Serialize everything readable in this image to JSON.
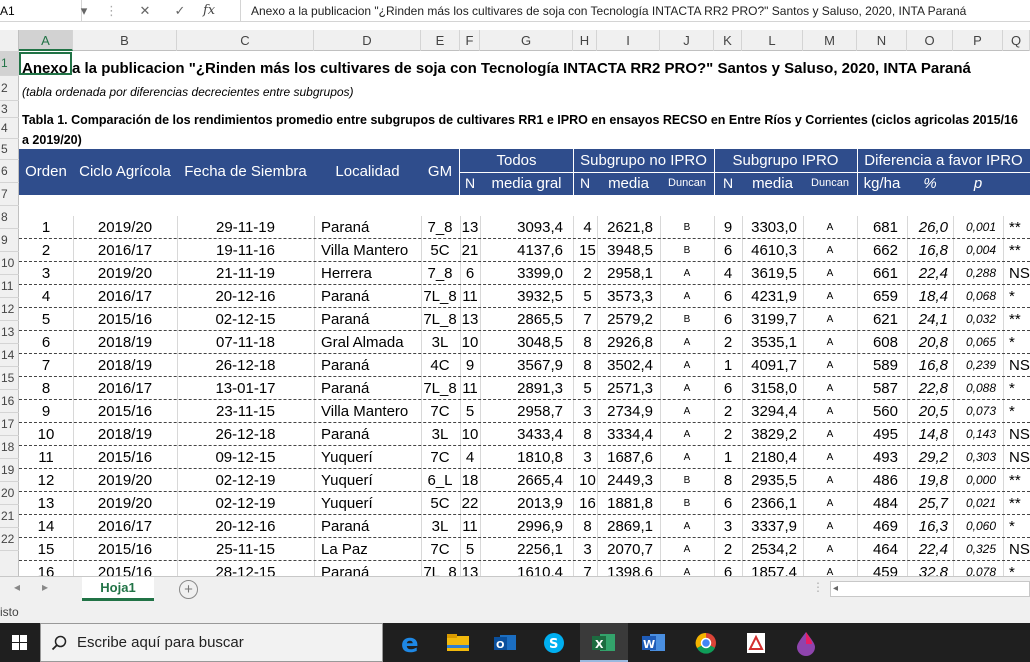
{
  "formula_bar": {
    "name_box": "A1",
    "fx": "fx",
    "content": "Anexo a la publicacion \"¿Rinden más los cultivares de soja con Tecnología INTACTA RR2 PRO?\"  Santos y Saluso, 2020, INTA Paraná"
  },
  "columns": [
    "A",
    "B",
    "C",
    "D",
    "E",
    "F",
    "G",
    "H",
    "I",
    "J",
    "K",
    "L",
    "M",
    "N",
    "O",
    "P",
    "Q"
  ],
  "rows": [
    "1",
    "2",
    "3",
    "4",
    "5",
    "6",
    "7",
    "8",
    "9",
    "10",
    "11",
    "12",
    "13",
    "14",
    "15",
    "16",
    "17",
    "18",
    "19",
    "20",
    "21",
    "22"
  ],
  "sheet": {
    "title": "Anexo a la publicacion \"¿Rinden más los cultivares de soja con Tecnología INTACTA RR2 PRO?\"  Santos y Saluso, 2020, INTA Paraná",
    "subtitle": "(tabla ordenada por diferencias decrecientes entre subgrupos)",
    "table_title": "Tabla 1. Comparación de los rendimientos promedio entre subgrupos de cultivares RR1 e IPRO en ensayos RECSO en Entre Ríos y Corrientes (ciclos agricolas 2015/16 a 2019/20)"
  },
  "table_header": {
    "orden": "Orden",
    "ciclo": "Ciclo Agrícola",
    "fecha": "Fecha de Siembra",
    "localidad": "Localidad",
    "gm": "GM",
    "todos": "Todos",
    "no_ipro": "Subgrupo no IPRO",
    "ipro": "Subgrupo IPRO",
    "diferencia": "Diferencia a favor IPRO",
    "n": "N",
    "media_gral": "media gral",
    "media": "media",
    "duncan": "Duncan",
    "kgha": "kg/ha",
    "pct": "%",
    "p": "p"
  },
  "table_rows": [
    [
      "1",
      "2019/20",
      "29-11-19",
      "Paraná",
      "7_8",
      "13",
      "3093,4",
      "4",
      "2621,8",
      "B",
      "9",
      "3303,0",
      "A",
      "681",
      "26,0",
      "0,001",
      "**"
    ],
    [
      "2",
      "2016/17",
      "19-11-16",
      "Villa Mantero",
      "5C",
      "21",
      "4137,6",
      "15",
      "3948,5",
      "B",
      "6",
      "4610,3",
      "A",
      "662",
      "16,8",
      "0,004",
      "**"
    ],
    [
      "3",
      "2019/20",
      "21-11-19",
      "Herrera",
      "7_8",
      "6",
      "3399,0",
      "2",
      "2958,1",
      "A",
      "4",
      "3619,5",
      "A",
      "661",
      "22,4",
      "0,288",
      "NS"
    ],
    [
      "4",
      "2016/17",
      "20-12-16",
      "Paraná",
      "7L_8",
      "11",
      "3932,5",
      "5",
      "3573,3",
      "A",
      "6",
      "4231,9",
      "A",
      "659",
      "18,4",
      "0,068",
      "*"
    ],
    [
      "5",
      "2015/16",
      "02-12-15",
      "Paraná",
      "7L_8",
      "13",
      "2865,5",
      "7",
      "2579,2",
      "B",
      "6",
      "3199,7",
      "A",
      "621",
      "24,1",
      "0,032",
      "**"
    ],
    [
      "6",
      "2018/19",
      "07-11-18",
      "Gral Almada",
      "3L",
      "10",
      "3048,5",
      "8",
      "2926,8",
      "A",
      "2",
      "3535,1",
      "A",
      "608",
      "20,8",
      "0,065",
      "*"
    ],
    [
      "7",
      "2018/19",
      "26-12-18",
      "Paraná",
      "4C",
      "9",
      "3567,9",
      "8",
      "3502,4",
      "A",
      "1",
      "4091,7",
      "A",
      "589",
      "16,8",
      "0,239",
      "NS"
    ],
    [
      "8",
      "2016/17",
      "13-01-17",
      "Paraná",
      "7L_8",
      "11",
      "2891,3",
      "5",
      "2571,3",
      "A",
      "6",
      "3158,0",
      "A",
      "587",
      "22,8",
      "0,088",
      "*"
    ],
    [
      "9",
      "2015/16",
      "23-11-15",
      "Villa Mantero",
      "7C",
      "5",
      "2958,7",
      "3",
      "2734,9",
      "A",
      "2",
      "3294,4",
      "A",
      "560",
      "20,5",
      "0,073",
      "*"
    ],
    [
      "10",
      "2018/19",
      "26-12-18",
      "Paraná",
      "3L",
      "10",
      "3433,4",
      "8",
      "3334,4",
      "A",
      "2",
      "3829,2",
      "A",
      "495",
      "14,8",
      "0,143",
      "NS"
    ],
    [
      "11",
      "2015/16",
      "09-12-15",
      "Yuquerí",
      "7C",
      "4",
      "1810,8",
      "3",
      "1687,6",
      "A",
      "1",
      "2180,4",
      "A",
      "493",
      "29,2",
      "0,303",
      "NS"
    ],
    [
      "12",
      "2019/20",
      "02-12-19",
      "Yuquerí",
      "6_L",
      "18",
      "2665,4",
      "10",
      "2449,3",
      "B",
      "8",
      "2935,5",
      "A",
      "486",
      "19,8",
      "0,000",
      "**"
    ],
    [
      "13",
      "2019/20",
      "02-12-19",
      "Yuquerí",
      "5C",
      "22",
      "2013,9",
      "16",
      "1881,8",
      "B",
      "6",
      "2366,1",
      "A",
      "484",
      "25,7",
      "0,021",
      "**"
    ],
    [
      "14",
      "2016/17",
      "20-12-16",
      "Paraná",
      "3L",
      "11",
      "2996,9",
      "8",
      "2869,1",
      "A",
      "3",
      "3337,9",
      "A",
      "469",
      "16,3",
      "0,060",
      "*"
    ],
    [
      "15",
      "2015/16",
      "25-11-15",
      "La Paz",
      "7C",
      "5",
      "2256,1",
      "3",
      "2070,7",
      "A",
      "2",
      "2534,2",
      "A",
      "464",
      "22,4",
      "0,325",
      "NS"
    ],
    [
      "16",
      "2015/16",
      "28-12-15",
      "Paraná",
      "7L_8",
      "13",
      "1610,4",
      "7",
      "1398,6",
      "A",
      "6",
      "1857,4",
      "A",
      "459",
      "32,8",
      "0,078",
      "*"
    ]
  ],
  "sheet_tab": "Hoja1",
  "add_sheet": "+",
  "status": "isto",
  "taskbar": {
    "search_placeholder": "Escribe aquí para buscar",
    "icons": [
      "windows-start-icon",
      "search-icon",
      "edge-icon",
      "file-explorer-icon",
      "outlook-icon",
      "skype-icon",
      "excel-icon",
      "word-icon",
      "chrome-icon",
      "acrobat-icon",
      "paint-icon"
    ]
  },
  "colors": {
    "header_band": "#2f4d8c",
    "excel_green": "#217346",
    "taskbar": "#1f1f1f"
  }
}
